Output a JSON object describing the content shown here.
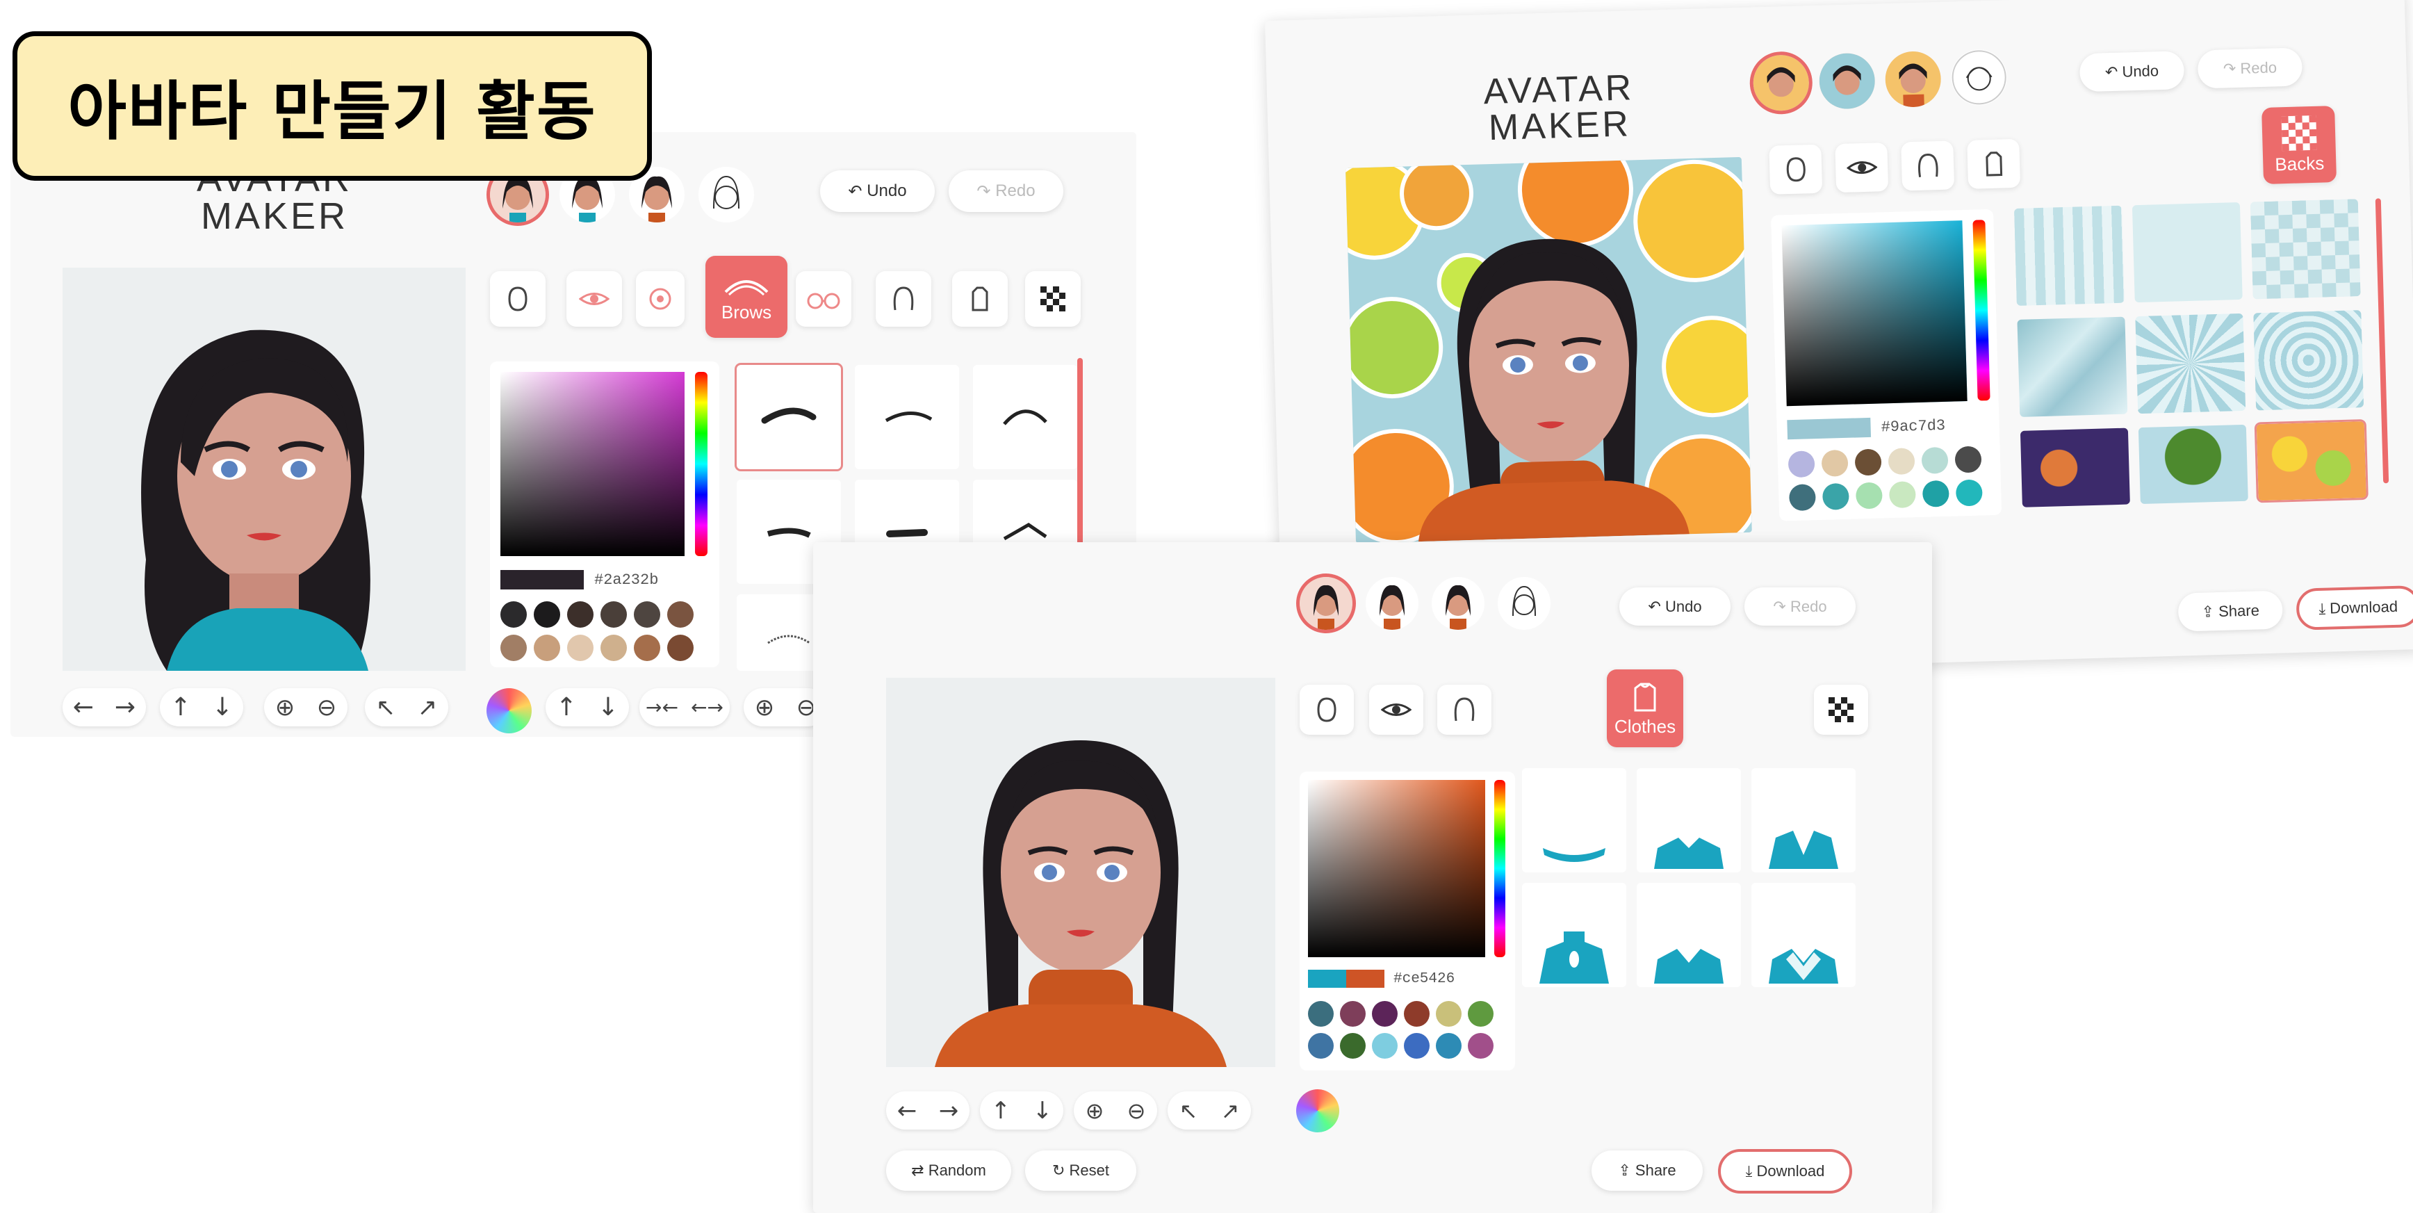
{
  "title": "아바타 만들기 활동",
  "logo": {
    "line1": "AVATAR",
    "line2": "MAKER"
  },
  "undo_label": "Undo",
  "redo_label": "Redo",
  "share_label": "Share",
  "download_label": "Download",
  "random_label": "Random",
  "reset_label": "Reset",
  "panel_a": {
    "active_category": "Brows",
    "hex": "#2a232b",
    "swatches": [
      "#2b2a2c",
      "#1c1b1c",
      "#3c2f2a",
      "#4a3f39",
      "#4e4540",
      "#7a5440",
      "#a17e65",
      "#c89f7c",
      "#e1c7ad",
      "#cfb08d",
      "#a56e4b",
      "#7a4a32"
    ]
  },
  "panel_b": {
    "active_category": "Backs",
    "hex": "#9ac7d3",
    "swatches": [
      "#b5b5e0",
      "#e1c8a5",
      "#6b4f35",
      "#e6dcc5",
      "#b7dcd5",
      "#4b4b4b",
      "#3f6f7c",
      "#3aa4a8",
      "#a6e0b0",
      "#c9e8c0",
      "#1fa1a5",
      "#22b7bb"
    ]
  },
  "panel_c": {
    "active_category": "Clothes",
    "hex": "#ce5426",
    "swatches": [
      "#3b6e7e",
      "#7e3e5a",
      "#5c2459",
      "#8e3b2a",
      "#c9c07a",
      "#5f9a3f",
      "#3f74a3",
      "#3a6a2c",
      "#7ecde0",
      "#3c6cc1",
      "#2d8bb5",
      "#a14f8a"
    ]
  }
}
